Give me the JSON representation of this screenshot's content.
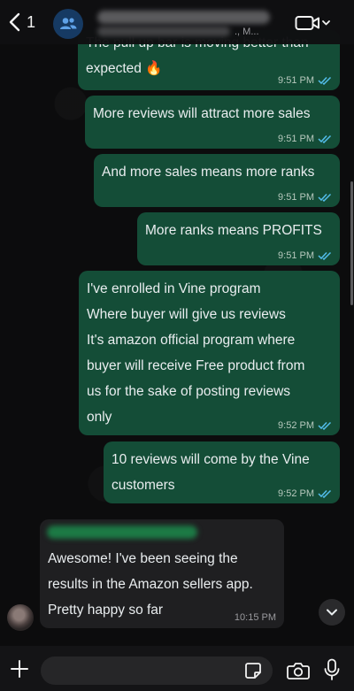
{
  "header": {
    "back_count": "1",
    "subtitle_tail": "., M...",
    "icons": [
      "chevron-left-icon",
      "group-icon",
      "video-camera-icon",
      "chevron-down-icon"
    ]
  },
  "messages": [
    {
      "text": "The pull up bar is moving better than\nexpected 🔥",
      "time": "9:51 PM",
      "direction": "out",
      "status": "read"
    },
    {
      "text": "More reviews will attract more sales",
      "time": "9:51 PM",
      "direction": "out",
      "status": "read"
    },
    {
      "text": "And more sales means more ranks",
      "time": "9:51 PM",
      "direction": "out",
      "status": "read"
    },
    {
      "text": "More ranks means PROFITS",
      "time": "9:51 PM",
      "direction": "out",
      "status": "read"
    },
    {
      "text": "I've enrolled in Vine program\nWhere buyer will give us reviews\nIt's amazon official program where\nbuyer will receive Free product from\nus for the sake of posting reviews\nonly",
      "time": "9:52 PM",
      "direction": "out",
      "status": "read"
    },
    {
      "text": "10 reviews will come by the Vine\ncustomers",
      "time": "9:52 PM",
      "direction": "out",
      "status": "read"
    },
    {
      "text": "Awesome! I've been seeing the\nresults in the Amazon sellers app.\nPretty happy so far",
      "time": "10:15 PM",
      "direction": "in"
    }
  ],
  "composer": {
    "placeholder": "",
    "icons": [
      "plus-icon",
      "sticker-icon",
      "camera-icon",
      "microphone-icon"
    ]
  },
  "colors": {
    "outgoing_bubble": "#144d37",
    "incoming_bubble": "#1f1f21",
    "read_ticks": "#53bdeb",
    "background": "#0c0c0d"
  }
}
